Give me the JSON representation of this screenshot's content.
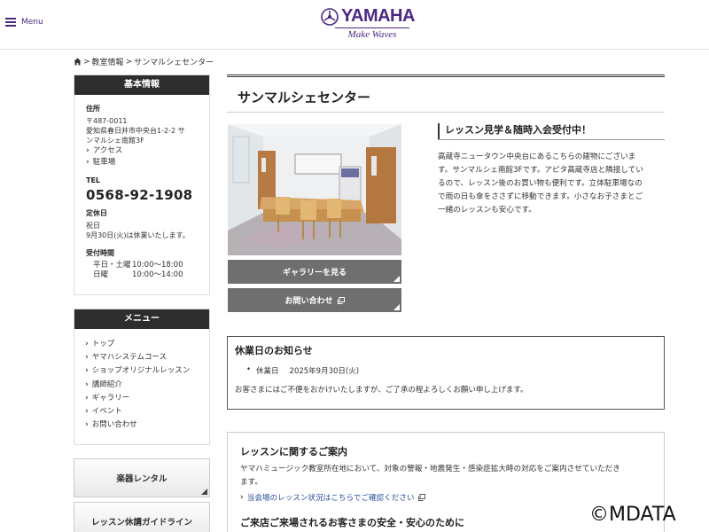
{
  "header": {
    "menu_label": "Menu",
    "logo_text": "YAMAHA",
    "logo_tagline": "Make Waves",
    "brand_color": "#4b2886"
  },
  "breadcrumb": {
    "home_icon": "home-icon",
    "items": [
      "教室情報",
      "サンマルシェセンター"
    ],
    "separator": ">"
  },
  "sidebar": {
    "info": {
      "heading": "基本情報",
      "address_label": "住所",
      "address_lines": [
        "〒487-0011",
        "愛知県春日井市中央台1-2-2 サ",
        "ンマルシェ南館3F"
      ],
      "links": [
        "アクセス",
        "駐車場"
      ],
      "tel_label": "TEL",
      "tel": "0568-92-1908",
      "holiday_label": "定休日",
      "holiday_lines": [
        "祝日",
        "9月30日(火)は休業いたします。"
      ],
      "hours_label": "受付時間",
      "hours": [
        {
          "days": "平日・土曜",
          "time": "10:00～18:00"
        },
        {
          "days": "日曜",
          "time": "10:00～14:00"
        }
      ]
    },
    "menu": {
      "heading": "メニュー",
      "items": [
        "トップ",
        "ヤマハシステムコース",
        "ショップオリジナルレッスン",
        "講師紹介",
        "ギャラリー",
        "イベント",
        "お問い合わせ"
      ]
    },
    "buttons": [
      "楽器レンタル",
      "レッスン休講ガイドライン"
    ]
  },
  "main": {
    "title": "サンマルシェセンター",
    "gallery_button": "ギャラリーを見る",
    "contact_button": "お問い合わせ",
    "feature": {
      "heading": "レッスン見学＆随時入会受付中！",
      "lines": [
        "高蔵寺ニュータウン中央台にあるこちらの建物にございま",
        "す。サンマルシェ南館3Fです。アピタ高蔵寺店と隣接してい",
        "るので、レッスン後のお買い物も便利です。立体駐車場なの",
        "で雨の日も傘をささずに移動できます。小さなお子さまとご",
        "一緒のレッスンも安心です。"
      ]
    },
    "notice": {
      "title": "休業日のお知らせ",
      "item_label": "休業日",
      "item_date": "2025年9月30日(火)",
      "text": "お客さまにはご不便をおかけいたしますが、ご了承の程よろしくお願い申し上げます。"
    },
    "lesson": {
      "title": "レッスンに関するご案内",
      "text_lines": [
        "ヤマハミュージック教室所在地において、対象の警報・地震発生・感染症拡大時の対応をご案内させていただき",
        "ます。"
      ],
      "link": "当会場のレッスン状況はこちらでご確認ください",
      "subtitle": "ご来店ご来場されるお客さまの安全・安心のために"
    }
  },
  "watermark": "©MDATA"
}
